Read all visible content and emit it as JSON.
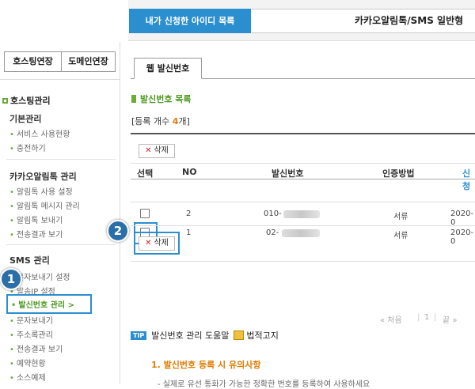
{
  "header": {
    "tab_mylist": "내가 신청한 아이디 목록",
    "service_title": "카카오알림톡/SMS 일반형"
  },
  "sidebar": {
    "btn_hosting": "호스팅연장",
    "btn_domain": "도메인연장",
    "section_title": "호스팅관리",
    "groups": [
      {
        "label": "기본관리",
        "items": [
          "서비스 사용현황",
          "충전하기"
        ]
      },
      {
        "label": "카카오알림톡 관리",
        "items": [
          "알림톡 사용 설정",
          "알림톡 메시지 관리",
          "알림톡 보내기",
          "전송결과 보기"
        ]
      },
      {
        "label": "SMS 관리",
        "items": [
          "문자보내기 설정",
          "발송IP 설정",
          "발신번호 관리 >",
          "문자보내기",
          "주소록관리",
          "전송결과 보기",
          "예약현황",
          "소스예제"
        ]
      }
    ]
  },
  "badges": [
    "1",
    "2"
  ],
  "main": {
    "tab_label": "웹 발신번호",
    "list_title": "발신번호 목록",
    "count_prefix": "[등록 개수 ",
    "count_value": "4",
    "count_suffix": "개]",
    "delete_label": "삭제",
    "columns": [
      "선택",
      "NO",
      "발신번호",
      "인증방법",
      "신청"
    ],
    "rows": [
      {
        "no": "1",
        "number": "02-",
        "method": "서류",
        "date": "2020-0"
      },
      {
        "no": "2",
        "number": "010-",
        "method": "서류",
        "date": "2020-0"
      }
    ],
    "pager": {
      "first": "« 처음",
      "current": "1",
      "last": "끝 »"
    },
    "tip_tag": "TIP",
    "tip_text": "발신번호 관리 도움말",
    "notice_text": "법적고지",
    "guide_title": "1. 발신번호 등록 시 유의사항",
    "guide_sub": "- 실제로 유선 통화가 가능한 정확한 번호를 등록하여 사용하세요"
  },
  "colors": {
    "accent": "#2b8fcf",
    "green": "#4c9a1f",
    "orange": "#e07b00"
  }
}
